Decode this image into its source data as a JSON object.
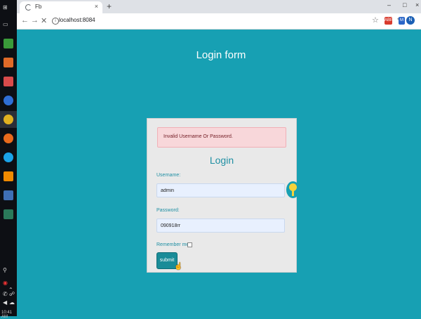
{
  "browser": {
    "tab_title": "Fb",
    "tab_close": "×",
    "new_tab": "+",
    "window_controls": [
      "–",
      "□",
      "×"
    ],
    "back": "←",
    "forward": "→",
    "stop": "✕",
    "address": "localhost:8084",
    "star": "☆",
    "extensions": [
      "ABP",
      "✎",
      "M"
    ],
    "profile_initial": "N",
    "menu": "⋮"
  },
  "taskbar": {
    "icons": [
      "file-explorer-icon",
      "pdf-app-icon",
      "database-app-icon",
      "location-app-icon",
      "chrome-icon",
      "firefox-icon",
      "skype-icon",
      "vlc-icon",
      "generic-app-icon",
      "media-app-icon"
    ],
    "tray": [
      "⚲",
      "◉",
      "⌃",
      "✆",
      "☍",
      "◀",
      "☁"
    ],
    "clock": "10:41 AM"
  },
  "page": {
    "title": "Login form",
    "alert": "Invalid Username Or Password.",
    "heading": "Login",
    "username_label": "Username:",
    "username_value": "admin",
    "password_label": "Password:",
    "password_value": "090918rr",
    "remember_label": "Remember me",
    "submit_label": "submit"
  },
  "colors": {
    "background": "#17a0b3",
    "accent": "#1f8fa3",
    "alert_bg": "#f8d7da",
    "button": "#1a8c98"
  }
}
